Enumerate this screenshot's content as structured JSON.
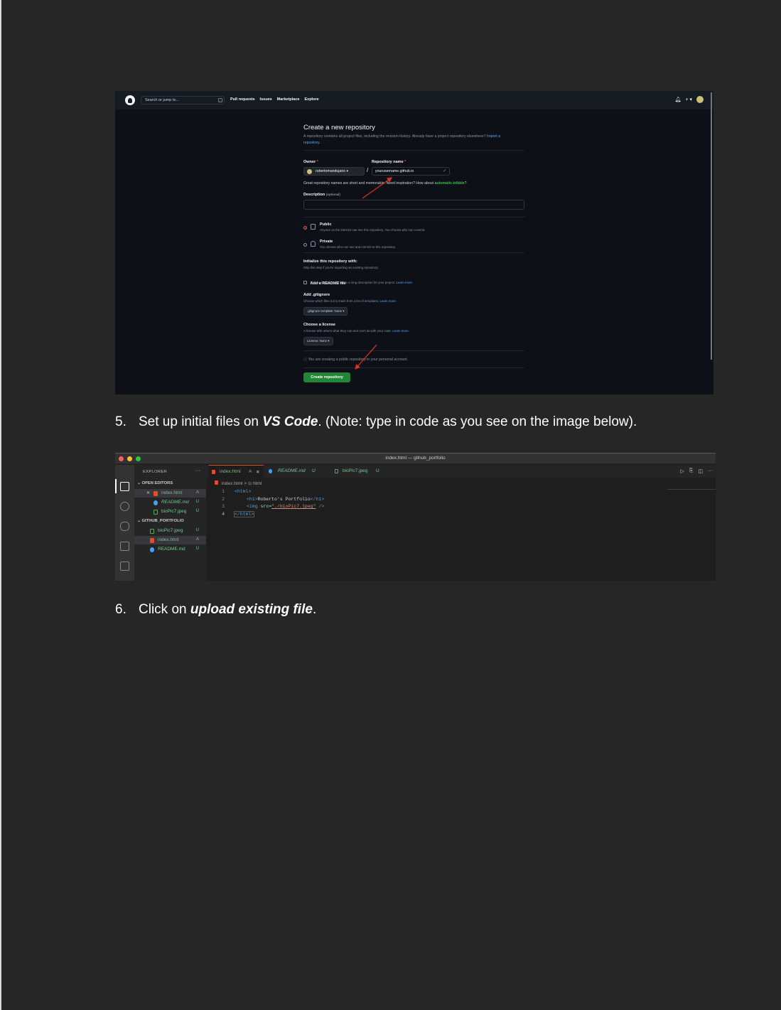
{
  "github": {
    "search_placeholder": "Search or jump to...",
    "search_shortcut": "/",
    "nav": [
      "Pull requests",
      "Issues",
      "Marketplace",
      "Explore"
    ],
    "header_icons": [
      "bell-icon",
      "plus-icon",
      "avatar"
    ],
    "plus_label": "+ ▾",
    "title": "Create a new repository",
    "subtitle": "A repository contains all project files, including the revision history. Already have a project repository elsewhere?",
    "import_link": "Import a repository.",
    "owner_label": "Owner",
    "owner_value": "robertomandujano ▾",
    "repo_label": "Repository name",
    "repo_value": "yourusername.github.io",
    "required_mark": "*",
    "separator": "/",
    "hint_prefix": "Great repository names are short and memorable. Need inspiration? How about",
    "hint_suggestion": "automatic-tribble",
    "hint_suffix": "?",
    "description_label": "Description",
    "description_optional": "(optional)",
    "public_label": "Public",
    "public_desc": "Anyone on the internet can see this repository. You choose who can commit.",
    "private_label": "Private",
    "private_desc": "You choose who can see and commit to this repository.",
    "init_heading": "Initialize this repository with:",
    "init_sub": "Skip this step if you're importing an existing repository.",
    "readme_label": "Add a README file",
    "readme_desc": "This is where you can write a long description for your project.",
    "learn_more": "Learn more.",
    "gitignore_heading": "Add .gitignore",
    "gitignore_desc": "Choose which files not to track from a list of templates.",
    "gitignore_select": ".gitignore template: None ▾",
    "license_heading": "Choose a license",
    "license_desc": "A license tells others what they can and can't do with your code.",
    "license_select": "License: None ▾",
    "notice": "You are creating a public repository in your personal account.",
    "create_button": "Create repository"
  },
  "steps": {
    "step5_num": "5.",
    "step5_pre": "Set up initial files on ",
    "step5_em": "VS Code",
    "step5_post": ". (Note: type in code as you see on the image below).",
    "step6_num": "6.",
    "step6_pre": "Click on ",
    "step6_em": "upload existing file",
    "step6_post": "."
  },
  "vscode": {
    "window_title": "index.html — github_portfolio",
    "explorer_title": "EXPLORER",
    "explorer_more": "···",
    "open_editors": "OPEN EDITORS",
    "project": "GITHUB_PORTFOLIO",
    "open_files": [
      {
        "name": "index.html",
        "status": "A",
        "close": "✕"
      },
      {
        "name": "README.md",
        "status": "U"
      },
      {
        "name": "bioPic7.jpeg",
        "status": "U"
      }
    ],
    "project_files": [
      {
        "name": "bioPic7.jpeg",
        "status": "U"
      },
      {
        "name": "index.html",
        "status": "A"
      },
      {
        "name": "README.md",
        "status": "U"
      }
    ],
    "tabs": [
      {
        "name": "index.html",
        "status": "A",
        "close": "✕"
      },
      {
        "name": "README.md",
        "status": "U"
      },
      {
        "name": "bioPic7.jpeg",
        "status": "U"
      }
    ],
    "breadcrumb_file": "index.html",
    "breadcrumb_sep": ">",
    "breadcrumb_symbol": "html",
    "toolbar": [
      "▷",
      "⎘",
      "◫",
      "···"
    ],
    "line_numbers": [
      "1",
      "2",
      "3",
      "4"
    ],
    "code": {
      "l1_tag": "<html>",
      "l2_open": "<h1>",
      "l2_text": "Roberto's Portfolio",
      "l2_close": "</h1>",
      "l3_tag": "<img ",
      "l3_attr": "src=",
      "l3_val": "\"./bioPic7.jpeg\"",
      "l3_end": " />",
      "l4_tag": "</html>"
    }
  }
}
